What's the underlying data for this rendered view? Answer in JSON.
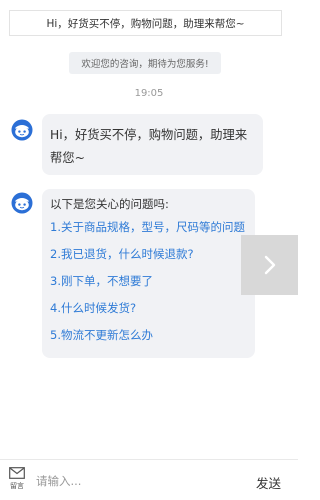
{
  "top_banner": {
    "text": "Hi，好货买不停，购物问题，助理来帮您~"
  },
  "welcome_notice": {
    "text": "欢迎您的咨询，期待为您服务!"
  },
  "timestamp": "19:05",
  "messages": {
    "greeting": {
      "text": "Hi，好货买不停，购物问题，助理来帮您~"
    },
    "faq": {
      "title": "以下是您关心的问题吗:",
      "items": [
        {
          "label": "1.关于商品规格，型号，尺码等的问题"
        },
        {
          "label": "2.我已退货，什么时候退款?"
        },
        {
          "label": "3.刚下单，不想要了"
        },
        {
          "label": "4.什么时候发货?"
        },
        {
          "label": "5.物流不更新怎么办"
        }
      ]
    }
  },
  "input_bar": {
    "leave_message_label": "留言",
    "placeholder": "请输入...",
    "send_label": "发送"
  },
  "colors": {
    "link": "#2f7bd6",
    "avatar": "#2b6fd6",
    "bubble_bg": "#f1f2f5"
  },
  "icons": {
    "avatar": "robot-avatar-icon",
    "next": "chevron-right-icon",
    "leave_message": "envelope-icon"
  }
}
